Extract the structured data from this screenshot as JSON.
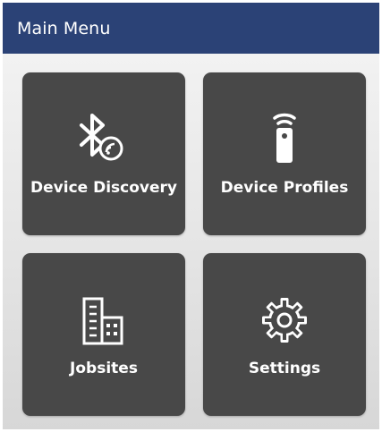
{
  "header": {
    "title": "Main Menu"
  },
  "tiles": [
    {
      "label": "Device Discovery",
      "icon": "bluetooth-search-icon"
    },
    {
      "label": "Device Profiles",
      "icon": "remote-control-icon"
    },
    {
      "label": "Jobsites",
      "icon": "building-icon"
    },
    {
      "label": "Settings",
      "icon": "gear-icon"
    }
  ],
  "colors": {
    "app_bar": "#2b4276",
    "tile_background": "#484848",
    "text": "#ffffff"
  }
}
